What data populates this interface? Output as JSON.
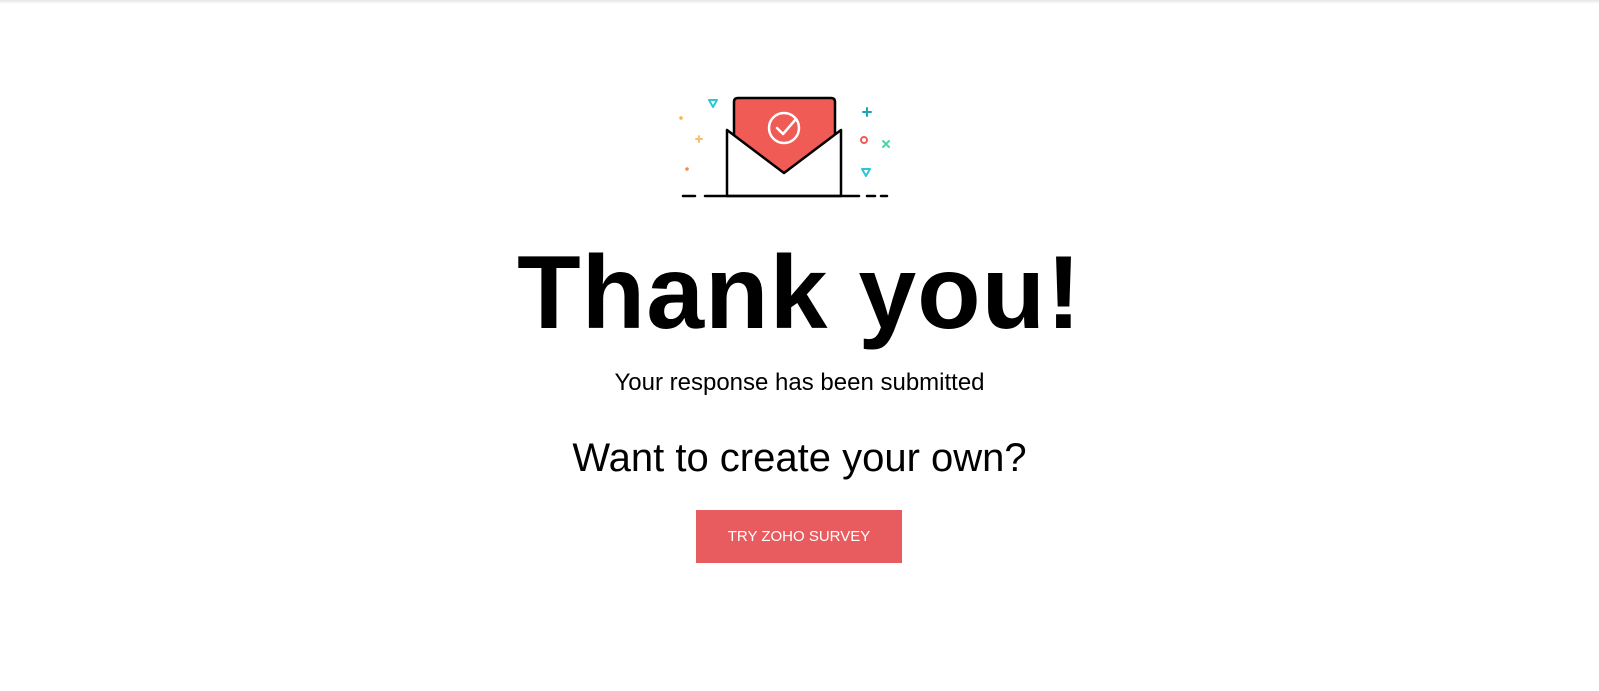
{
  "confirmation": {
    "title": "Thank you!",
    "subtitle": "Your response has been submitted",
    "prompt": "Want to create your own?",
    "cta_label": "TRY ZOHO SURVEY"
  },
  "icons": {
    "illustration": "envelope-check-icon"
  },
  "colors": {
    "accent": "#e85c5f",
    "letter": "#f15b55",
    "text": "#000000",
    "background": "#ffffff"
  }
}
